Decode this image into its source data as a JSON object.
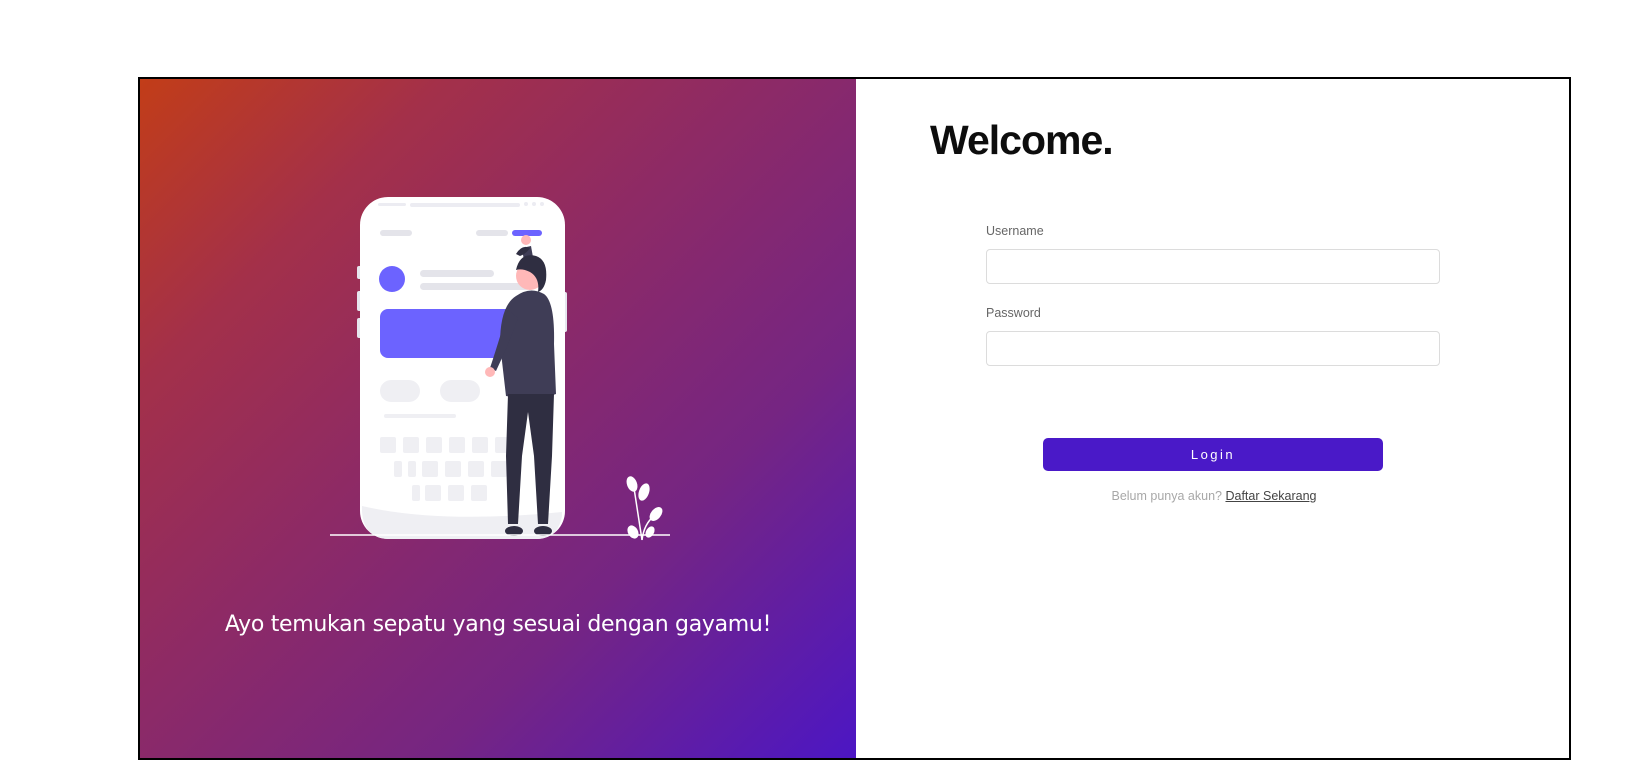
{
  "hero": {
    "tagline": "Ayo temukan sepatu yang sesuai dengan gayamu!"
  },
  "login_form": {
    "title": "Welcome.",
    "username_label": "Username",
    "username_value": "",
    "password_label": "Password",
    "password_value": "",
    "login_button": "Login",
    "register_prompt": "Belum punya akun?",
    "register_link": "Daftar Sekarang"
  },
  "colors": {
    "gradient_start": "#c23d18",
    "gradient_end": "#4c16c4",
    "primary_button": "#4a19c8",
    "illustration_accent": "#6c63ff"
  },
  "icons": {
    "illustration": "person-with-phone-illustration",
    "plant": "plant-icon"
  }
}
